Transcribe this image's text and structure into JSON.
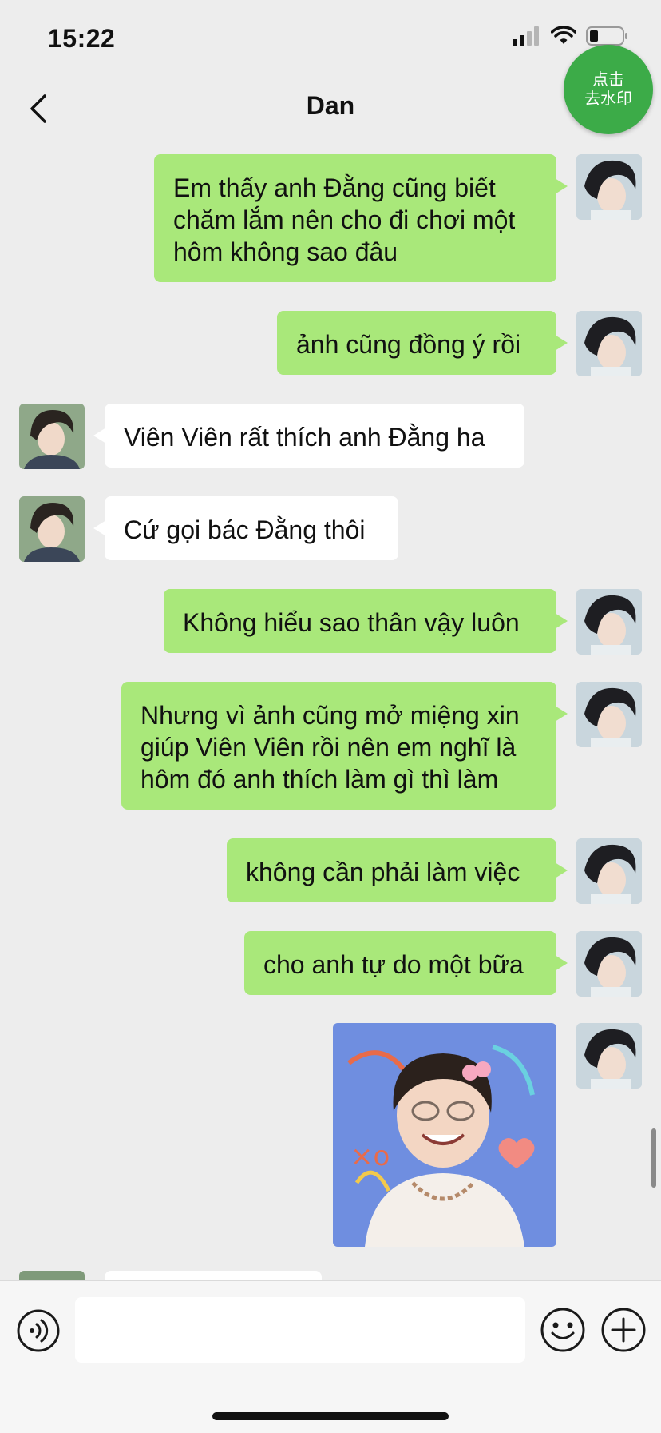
{
  "status_bar": {
    "time": "15:22"
  },
  "header": {
    "title": "Dan",
    "watermark_button": [
      "点击",
      "去水印"
    ]
  },
  "messages": [
    {
      "text": "Em thấy anh Đằng cũng biết chăm lắm nên cho đi chơi một hôm không sao đâu"
    },
    {
      "text": "ảnh cũng đồng ý rồi"
    },
    {
      "text": "Viên Viên rất thích anh Đằng ha"
    },
    {
      "text": "Cứ gọi bác Đằng thôi"
    },
    {
      "text": "Không hiểu sao thân vậy luôn"
    },
    {
      "text": "Nhưng vì ảnh cũng mở miệng xin giúp Viên Viên rồi nên em nghĩ là hôm đó anh thích làm gì thì làm"
    },
    {
      "text": "không cần phải làm việc"
    },
    {
      "text": "cho anh tự do một bữa"
    }
  ],
  "colors": {
    "sent_bubble": "#a9e87a",
    "received_bubble": "#ffffff",
    "background": "#ededed",
    "watermark_button": "#3cab48"
  }
}
